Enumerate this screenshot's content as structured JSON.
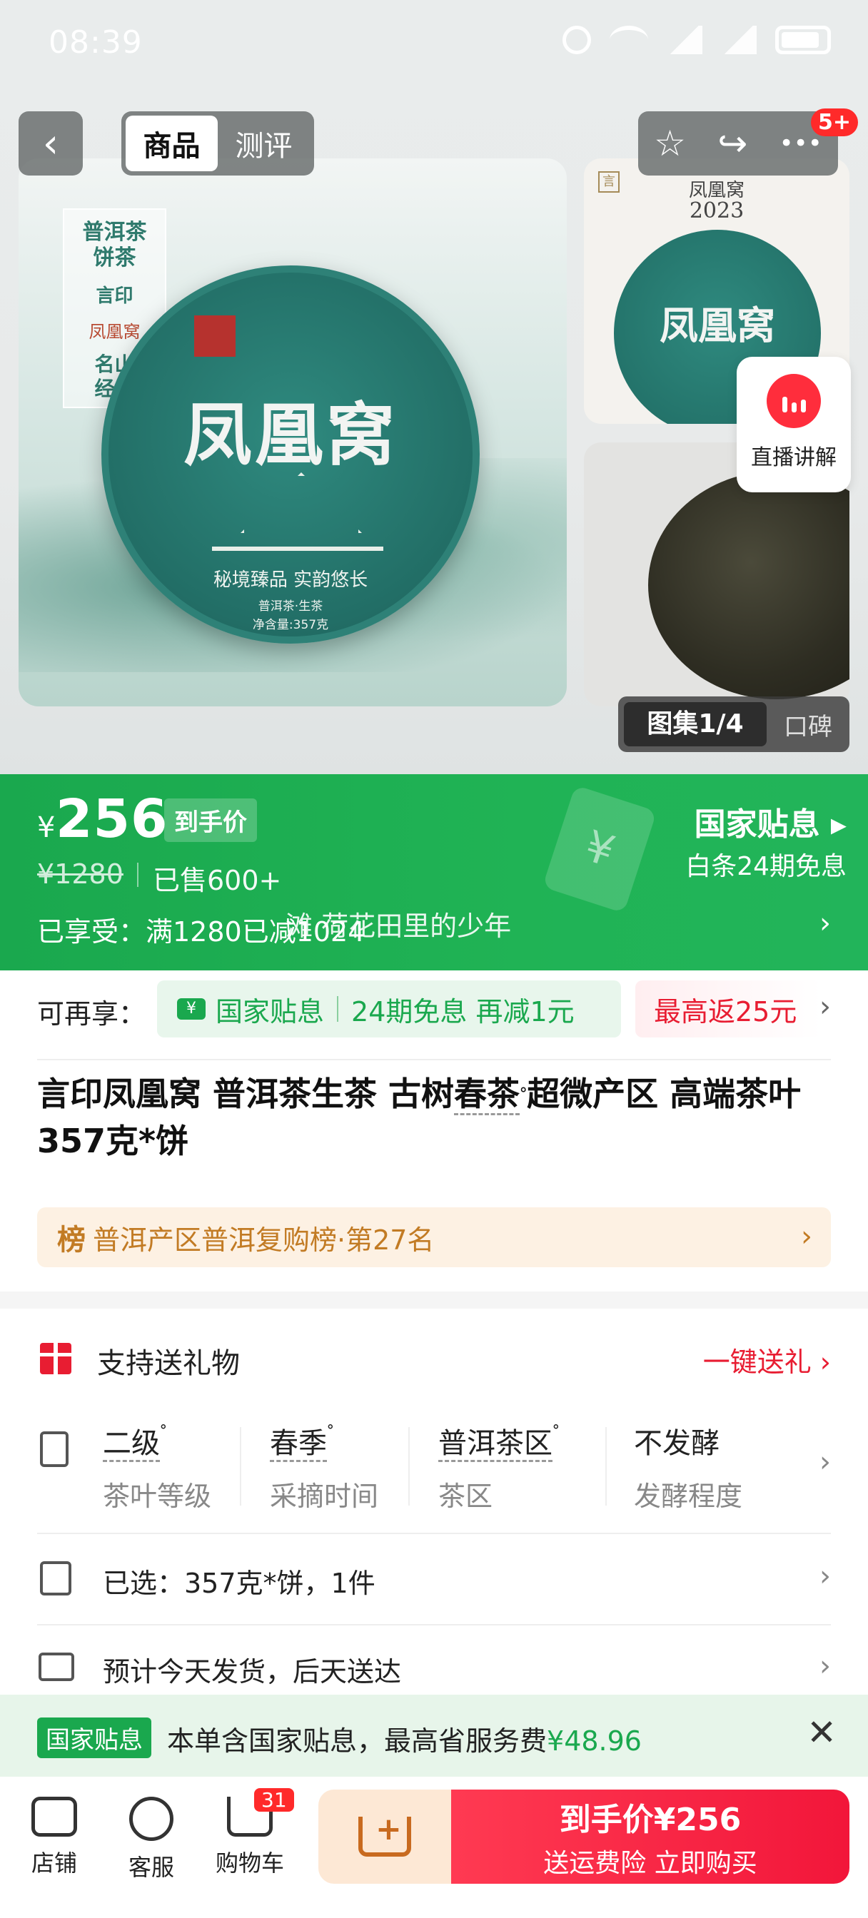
{
  "status_bar": {
    "time": "08:39"
  },
  "nav": {
    "back_icon": "‹",
    "tabs": [
      "商品",
      "测评"
    ],
    "star_icon": "☆",
    "share_icon": "↪",
    "more_icon": "•••",
    "notif_badge": "5+"
  },
  "gallery": {
    "label_card": {
      "line1": "普洱茶\n饼茶",
      "line2": "言印",
      "line3": "凤凰窝",
      "line4": "名山\n经典"
    },
    "cake_title": "凤凰窝",
    "cake_slogan": "秘境臻品 实韵悠长",
    "cake_small": "普洱茶·生茶\n净含量:357克",
    "thumb_logo": "言",
    "thumb_brand": "凤凰窝",
    "thumb_year": "2023",
    "thumb_cake_title": "凤凰窝",
    "live_label": "直播讲解",
    "counter": "图集1/4",
    "reviews_tab": "口碑"
  },
  "price": {
    "currency": "¥",
    "amount": "256",
    "tag": "到手价",
    "original": "¥1280",
    "sold": "已售600+",
    "coupon_icon": "¥",
    "subsidy": "国家贴息 ▸",
    "installment": "白条24期免息",
    "enjoyed": "已享受：满1280已减1024",
    "music": "滩 荷花田里的少年",
    "arrow": "›"
  },
  "extra": {
    "label": "可再享：",
    "chip_icon": "¥",
    "chip_a": "国家贴息",
    "chip_b": "24期免息 再减1元",
    "chip2": "最高返25元",
    "arrow": "›"
  },
  "title": {
    "before": "言印凤凰窝 普洱茶生茶 古树",
    "keyword": "春茶",
    "icon": "ᐤ",
    "after": "超微产区 高端茶叶 357克*饼"
  },
  "rank": {
    "badge": "榜",
    "text": "普洱产区普洱复购榜·第27名",
    "arrow": "›"
  },
  "gift": {
    "label": "支持送礼物",
    "action": "一键送礼 ›"
  },
  "attributes": [
    {
      "value": "二级",
      "key": "茶叶等级",
      "icon": "ᐤ"
    },
    {
      "value": "春季",
      "key": "采摘时间",
      "icon": "ᐤ"
    },
    {
      "value": "普洱茶区",
      "key": "茶区",
      "icon": "ᐤ"
    },
    {
      "value": "不发酵",
      "key": "发酵程度",
      "icon": ""
    }
  ],
  "selected": "已选：357克*饼，1件",
  "delivery": "预计今天发货，后天送达",
  "subsidy_banner": {
    "tag": "国家贴息",
    "text": "本单含国家贴息，最高省服务费",
    "amount": "¥48.96",
    "close": "✕"
  },
  "bottom": {
    "shop": "店铺",
    "service": "客服",
    "cart": "购物车",
    "cart_badge": "31",
    "buy_line1": "到手价¥256",
    "buy_line2": "送运费险 立即购买"
  }
}
